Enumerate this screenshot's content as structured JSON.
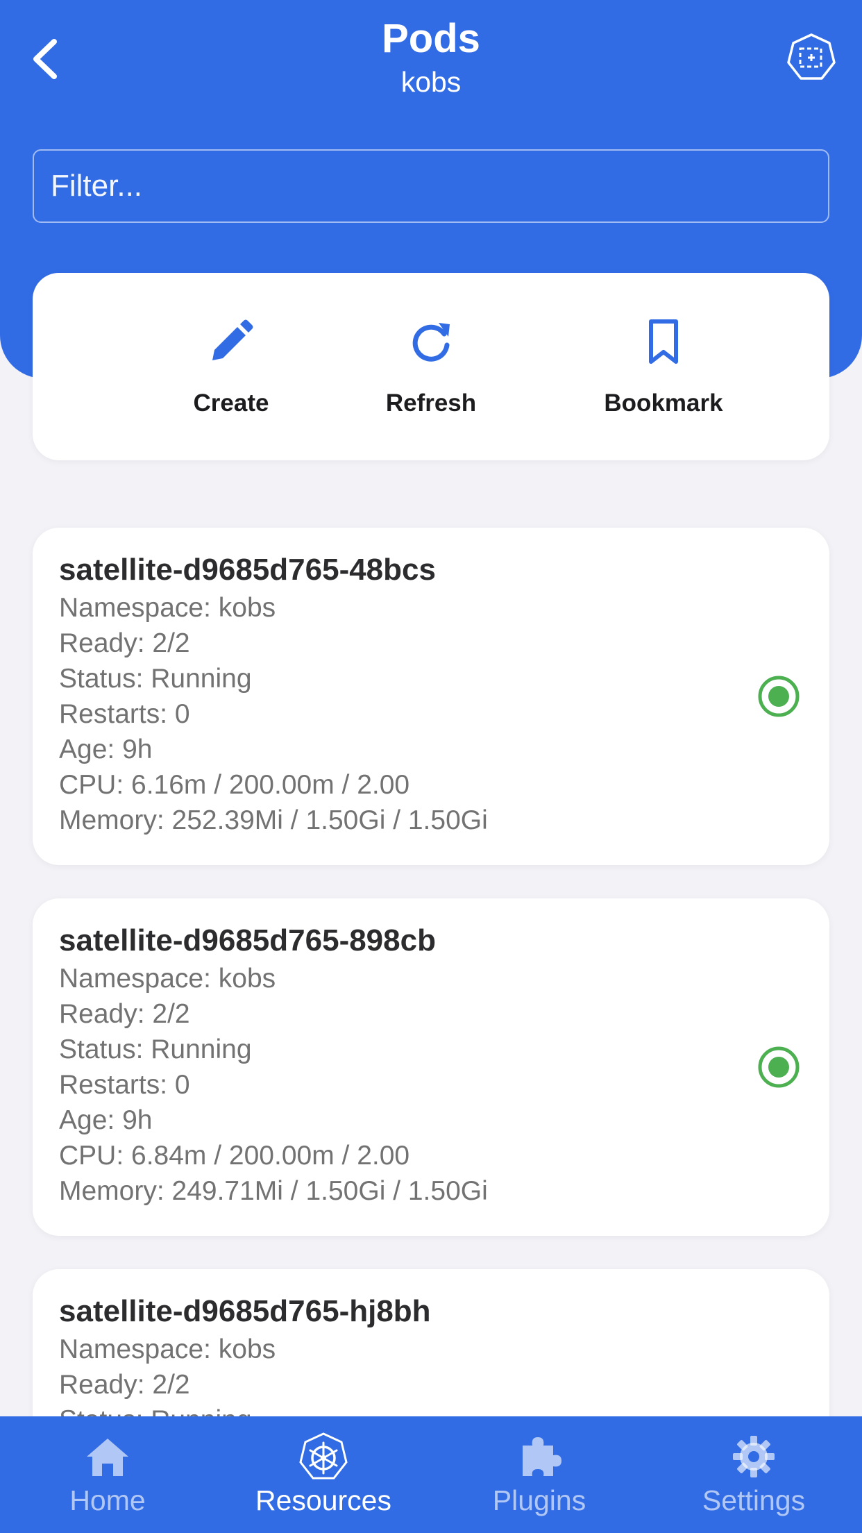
{
  "header": {
    "title": "Pods",
    "subtitle": "kobs",
    "back_icon": "chevron-left-icon",
    "cluster_icon": "kubernetes-cluster-icon"
  },
  "filter": {
    "placeholder": "Filter...",
    "value": ""
  },
  "actions": [
    {
      "label": "Create",
      "icon": "pencil-icon"
    },
    {
      "label": "Refresh",
      "icon": "refresh-icon"
    },
    {
      "label": "Bookmark",
      "icon": "bookmark-icon"
    }
  ],
  "pods": [
    {
      "name": "satellite-d9685d765-48bcs",
      "namespace": "Namespace: kobs",
      "ready": "Ready: 2/2",
      "status": "Status: Running",
      "restarts": "Restarts: 0",
      "age": "Age: 9h",
      "cpu": "CPU: 6.16m / 200.00m / 2.00",
      "memory": "Memory: 252.39Mi / 1.50Gi / 1.50Gi",
      "status_color": "#4caf50"
    },
    {
      "name": "satellite-d9685d765-898cb",
      "namespace": "Namespace: kobs",
      "ready": "Ready: 2/2",
      "status": "Status: Running",
      "restarts": "Restarts: 0",
      "age": "Age: 9h",
      "cpu": "CPU: 6.84m / 200.00m / 2.00",
      "memory": "Memory: 249.71Mi / 1.50Gi / 1.50Gi",
      "status_color": "#4caf50"
    },
    {
      "name": "satellite-d9685d765-hj8bh",
      "namespace": "Namespace: kobs",
      "ready": "Ready: 2/2",
      "status": "Status: Running"
    }
  ],
  "tabs": [
    {
      "label": "Home",
      "icon": "home-icon",
      "active": false
    },
    {
      "label": "Resources",
      "icon": "kubernetes-icon",
      "active": true
    },
    {
      "label": "Plugins",
      "icon": "puzzle-icon",
      "active": false
    },
    {
      "label": "Settings",
      "icon": "gear-icon",
      "active": false
    }
  ],
  "colors": {
    "brand": "#326ce5",
    "running": "#4caf50",
    "background": "#f2f2f7"
  }
}
